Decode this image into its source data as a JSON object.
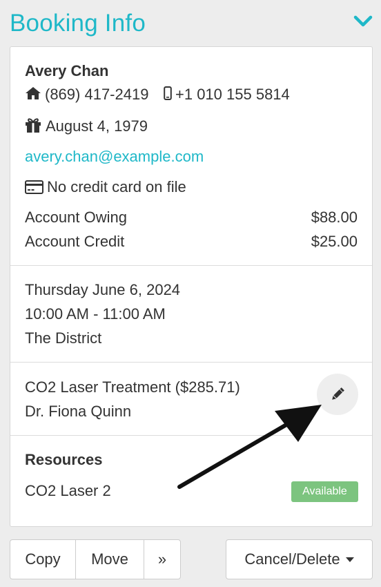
{
  "header": {
    "title": "Booking Info",
    "accent_color": "#1fb8c8",
    "collapse_icon": "chevron-down-icon"
  },
  "client": {
    "name": "Avery Chan",
    "home_phone": "(869) 417-2419",
    "mobile_phone": "+1 010 155 5814",
    "birthday": "August 4, 1979",
    "email": "avery.chan@example.com",
    "credit_card_status": "No credit card on file",
    "account_owing_label": "Account Owing",
    "account_owing_value": "$88.00",
    "account_credit_label": "Account Credit",
    "account_credit_value": "$25.00"
  },
  "appointment": {
    "date": "Thursday June 6, 2024",
    "time": "10:00 AM - 11:00 AM",
    "location": "The District"
  },
  "service": {
    "name": "CO2 Laser Treatment ($285.71)",
    "provider": "Dr. Fiona Quinn",
    "edit_icon": "pencil-icon"
  },
  "resources": {
    "heading": "Resources",
    "items": [
      {
        "name": "CO2 Laser 2",
        "status": "Available",
        "status_color": "#7cc47f"
      }
    ]
  },
  "actions": {
    "copy_label": "Copy",
    "move_label": "Move",
    "more_label": "»",
    "cancel_delete_label": "Cancel/Delete"
  }
}
